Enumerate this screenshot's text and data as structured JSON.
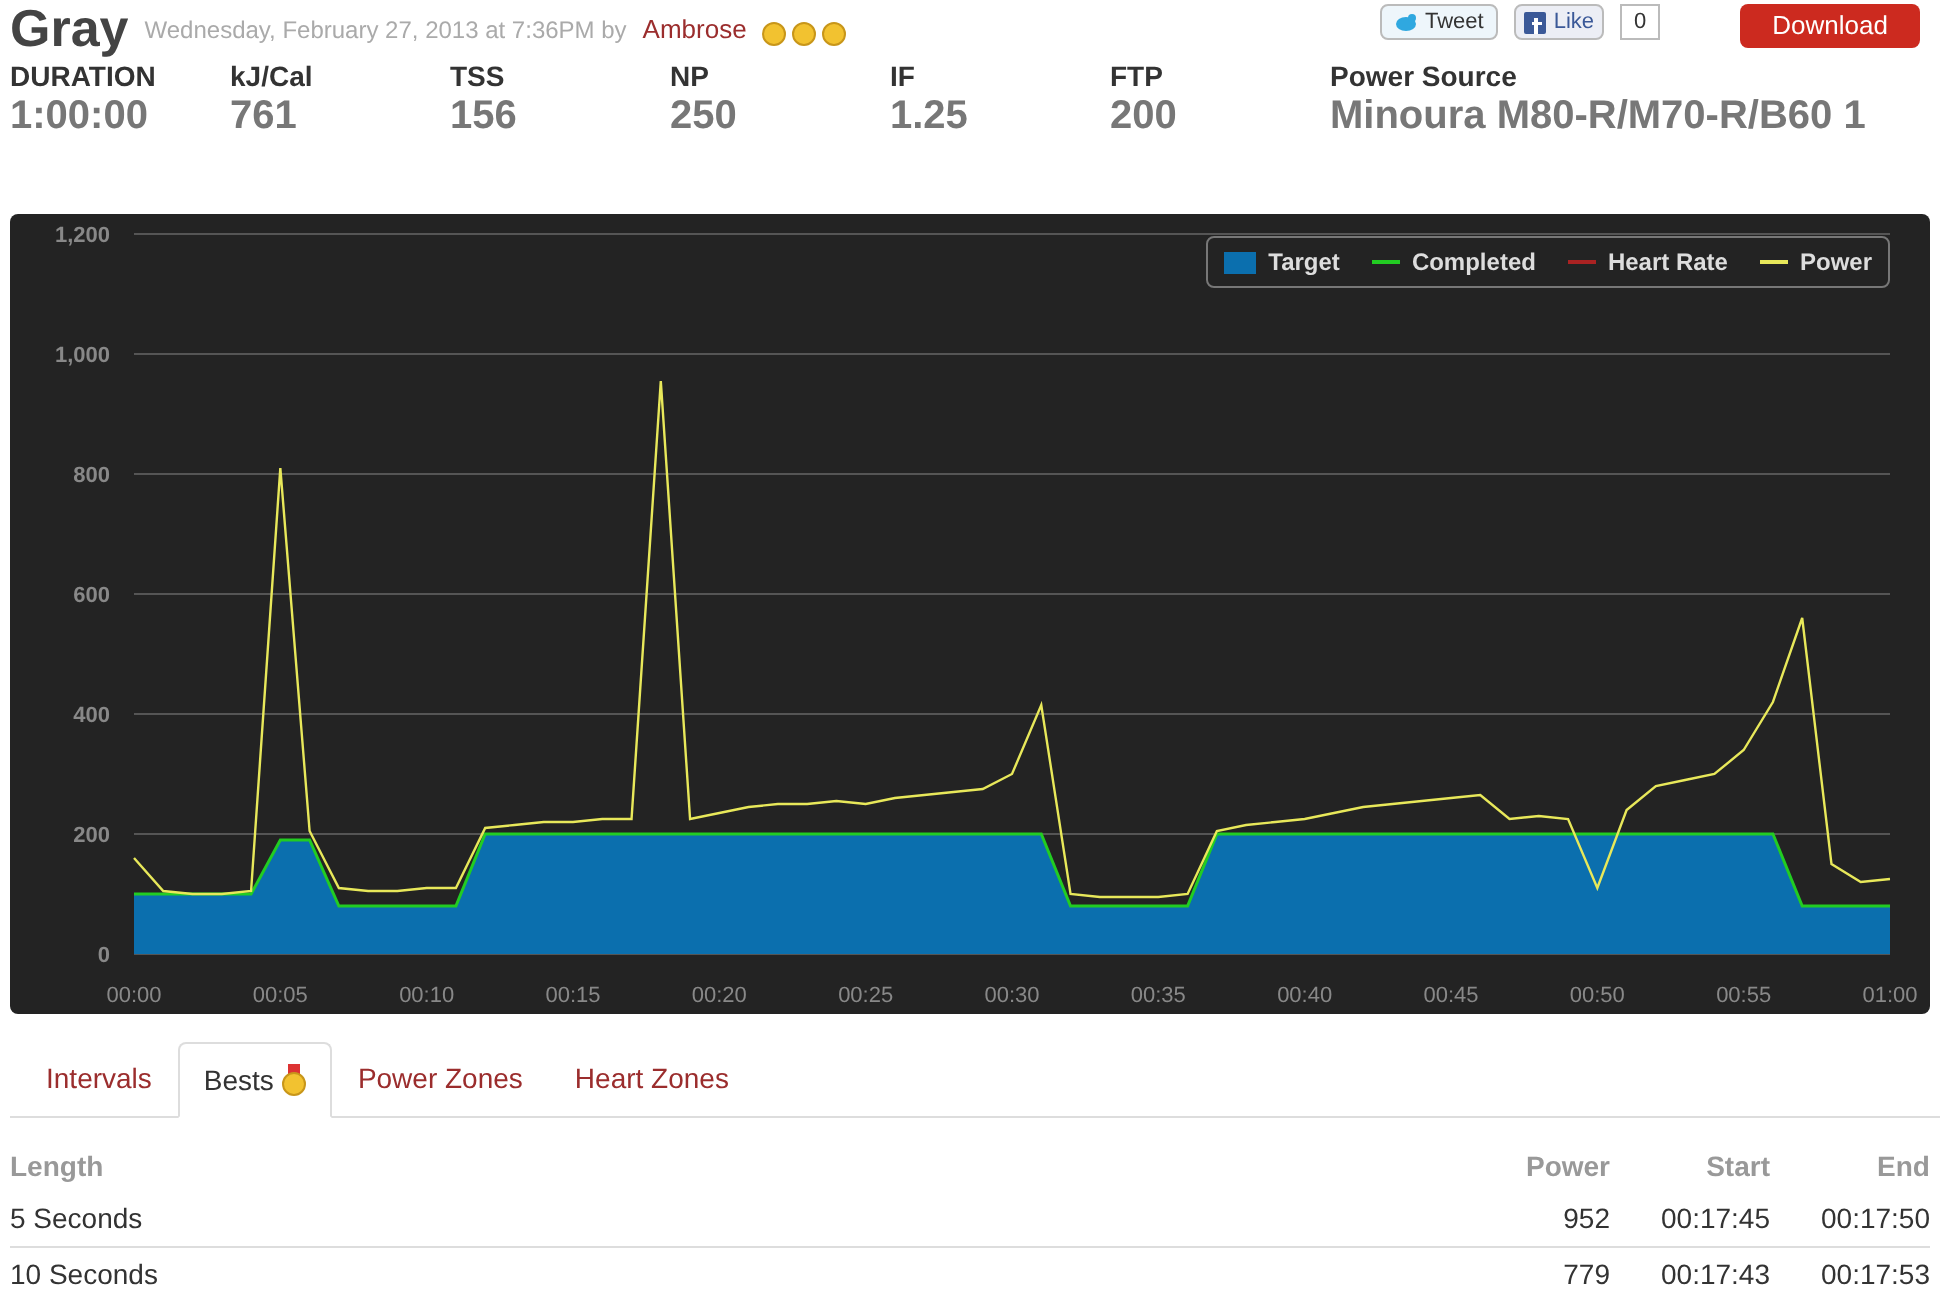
{
  "header": {
    "title": "Gray",
    "subtitle": "Wednesday, February 27, 2013 at 7:36PM by",
    "author": "Ambrose",
    "share": [
      {
        "label": "Tweet",
        "kind": "tweet"
      },
      {
        "label": "Like",
        "kind": "like"
      },
      {
        "label": "0",
        "kind": "count"
      }
    ],
    "download": "Download"
  },
  "stats": [
    {
      "label": "DURATION",
      "value": "1:00:00"
    },
    {
      "label": "kJ/Cal",
      "value": "761"
    },
    {
      "label": "TSS",
      "value": "156"
    },
    {
      "label": "NP",
      "value": "250"
    },
    {
      "label": "IF",
      "value": "1.25"
    },
    {
      "label": "FTP",
      "value": "200"
    },
    {
      "label": "Power Source",
      "value": "Minoura M80-R/M70-R/B60 1"
    }
  ],
  "chart_data": {
    "type": "area",
    "x": [
      0,
      1,
      2,
      3,
      4,
      5,
      6,
      7,
      8,
      9,
      10,
      11,
      12,
      13,
      14,
      15,
      16,
      17,
      18,
      19,
      20,
      21,
      22,
      23,
      24,
      25,
      26,
      27,
      28,
      29,
      30,
      31,
      32,
      33,
      34,
      35,
      36,
      37,
      38,
      39,
      40,
      41,
      42,
      43,
      44,
      45,
      46,
      47,
      48,
      49,
      50,
      51,
      52,
      53,
      54,
      55,
      56,
      57,
      58,
      59,
      60
    ],
    "series": [
      {
        "name": "Target",
        "color": "#0b6fae",
        "values": [
          100,
          100,
          100,
          100,
          100,
          190,
          190,
          80,
          80,
          80,
          80,
          80,
          200,
          200,
          200,
          200,
          200,
          200,
          200,
          200,
          200,
          200,
          200,
          200,
          200,
          200,
          200,
          200,
          200,
          200,
          200,
          200,
          80,
          80,
          80,
          80,
          80,
          200,
          200,
          200,
          200,
          200,
          200,
          200,
          200,
          200,
          200,
          200,
          200,
          200,
          200,
          200,
          200,
          200,
          200,
          200,
          200,
          80,
          80,
          80,
          80
        ]
      },
      {
        "name": "Completed",
        "type": "line",
        "color": "#22cc22",
        "values": [
          100,
          100,
          100,
          100,
          100,
          190,
          190,
          80,
          80,
          80,
          80,
          80,
          200,
          200,
          200,
          200,
          200,
          200,
          200,
          200,
          200,
          200,
          200,
          200,
          200,
          200,
          200,
          200,
          200,
          200,
          200,
          200,
          80,
          80,
          80,
          80,
          80,
          200,
          200,
          200,
          200,
          200,
          200,
          200,
          200,
          200,
          200,
          200,
          200,
          200,
          200,
          200,
          200,
          200,
          200,
          200,
          200,
          80,
          80,
          80,
          80
        ]
      },
      {
        "name": "Heart Rate",
        "type": "line",
        "color": "#aa2222",
        "values": [
          null,
          null,
          null,
          null,
          null,
          null,
          null,
          null,
          null,
          null,
          null,
          null,
          null,
          null,
          null,
          null,
          null,
          null,
          null,
          null,
          null,
          null,
          null,
          null,
          null,
          null,
          null,
          null,
          null,
          null,
          null,
          null,
          null,
          null,
          null,
          null,
          null,
          null,
          null,
          null,
          null,
          null,
          null,
          null,
          null,
          null,
          null,
          null,
          null,
          null,
          null,
          null,
          null,
          null,
          null,
          null,
          null,
          null,
          null,
          null,
          null
        ]
      },
      {
        "name": "Power",
        "type": "line",
        "color": "#e8e85a",
        "values": [
          160,
          105,
          100,
          100,
          105,
          810,
          205,
          110,
          105,
          105,
          110,
          110,
          210,
          215,
          220,
          220,
          225,
          225,
          955,
          225,
          235,
          245,
          250,
          250,
          255,
          250,
          260,
          265,
          270,
          275,
          300,
          415,
          100,
          95,
          95,
          95,
          100,
          205,
          215,
          220,
          225,
          235,
          245,
          250,
          255,
          260,
          265,
          225,
          230,
          225,
          110,
          240,
          280,
          290,
          300,
          340,
          420,
          560,
          150,
          120,
          125
        ]
      }
    ],
    "xlim": [
      0,
      60
    ],
    "ylim": [
      0,
      1200
    ],
    "grid": true,
    "legend": "top-right",
    "xticks": [
      {
        "value": 0,
        "label": "00:00"
      },
      {
        "value": 5,
        "label": "00:05"
      },
      {
        "value": 10,
        "label": "00:10"
      },
      {
        "value": 15,
        "label": "00:15"
      },
      {
        "value": 20,
        "label": "00:20"
      },
      {
        "value": 25,
        "label": "00:25"
      },
      {
        "value": 30,
        "label": "00:30"
      },
      {
        "value": 35,
        "label": "00:35"
      },
      {
        "value": 40,
        "label": "00:40"
      },
      {
        "value": 45,
        "label": "00:45"
      },
      {
        "value": 50,
        "label": "00:50"
      },
      {
        "value": 55,
        "label": "00:55"
      },
      {
        "value": 60,
        "label": "01:00"
      }
    ],
    "yticks": [
      {
        "value": 0,
        "label": "0"
      },
      {
        "value": 200,
        "label": "200"
      },
      {
        "value": 400,
        "label": "400"
      },
      {
        "value": 600,
        "label": "600"
      },
      {
        "value": 800,
        "label": "800"
      },
      {
        "value": 1000,
        "label": "1,000"
      },
      {
        "value": 1200,
        "label": "1,200"
      }
    ]
  },
  "tabs": [
    {
      "label": "Intervals",
      "selected": false,
      "medal": false
    },
    {
      "label": "Bests",
      "selected": true,
      "medal": true
    },
    {
      "label": "Power Zones",
      "selected": false,
      "medal": false
    },
    {
      "label": "Heart Zones",
      "selected": false,
      "medal": false
    }
  ],
  "table": {
    "columns": [
      "Length",
      "Power",
      "Start",
      "End"
    ],
    "rows": [
      [
        "5 Seconds",
        "952",
        "00:17:45",
        "00:17:50"
      ],
      [
        "10 Seconds",
        "779",
        "00:17:43",
        "00:17:53"
      ]
    ]
  }
}
